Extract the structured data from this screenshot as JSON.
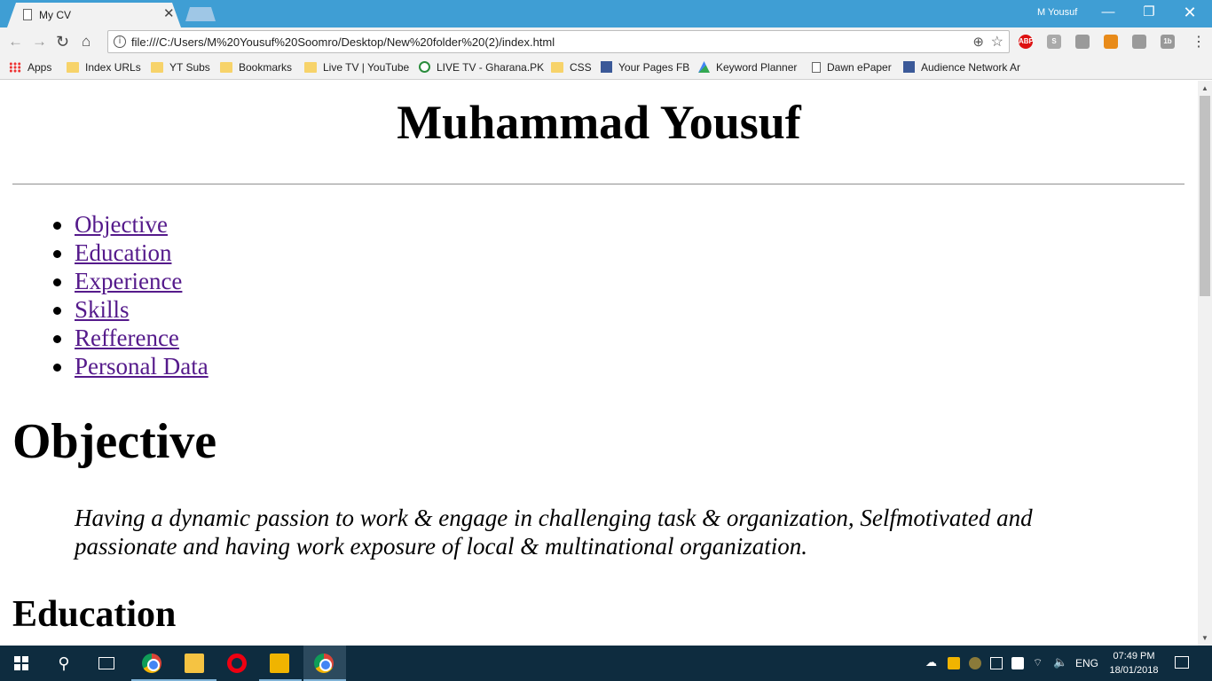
{
  "browser": {
    "tab_title": "My CV",
    "tab_close": "✕",
    "profile_name": "M Yousuf",
    "window_controls": {
      "minimize": "—",
      "maximize": "❐",
      "close": "✕"
    },
    "url": "file:///C:/Users/M%20Yousuf%20Soomro/Desktop/New%20folder%20(2)/index.html",
    "extensions": {
      "abp": "ABP",
      "s": "S",
      "onebee": "1b"
    }
  },
  "bookmarks": [
    {
      "label": "Apps",
      "icon": "apps-grid-icon"
    },
    {
      "label": "Index URLs",
      "icon": "folder-icon"
    },
    {
      "label": "YT Subs",
      "icon": "folder-icon"
    },
    {
      "label": "Bookmarks",
      "icon": "folder-icon"
    },
    {
      "label": "Live TV | YouTube",
      "icon": "folder-icon"
    },
    {
      "label": "LIVE TV - Gharana.PK",
      "icon": "gp-icon"
    },
    {
      "label": "CSS",
      "icon": "folder-icon"
    },
    {
      "label": "Your Pages FB",
      "icon": "facebook-icon"
    },
    {
      "label": "Keyword Planner",
      "icon": "adwords-icon"
    },
    {
      "label": "Dawn ePaper",
      "icon": "page-icon"
    },
    {
      "label": "Audience Network Ar",
      "icon": "facebook-icon"
    }
  ],
  "page": {
    "name": "Muhammad Yousuf",
    "nav": [
      "Objective",
      "Education",
      "Experience",
      "Skills",
      "Refference",
      "Personal Data"
    ],
    "objective_heading": "Objective",
    "objective_text": "Having a dynamic passion to work & engage in challenging task & organization, Selfmotivated and passionate and having work exposure of local & multinational organization.",
    "education_heading": "Education"
  },
  "taskbar": {
    "language": "ENG",
    "time": "07:49 PM",
    "date": "18/01/2018"
  },
  "colors": {
    "titlebar": "#3f9ed4",
    "visited_link": "#551a8b",
    "taskbar": "#0e2c3f"
  }
}
